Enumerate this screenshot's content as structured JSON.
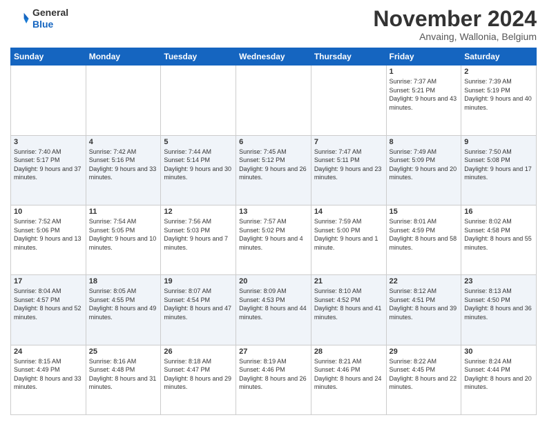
{
  "logo": {
    "general": "General",
    "blue": "Blue"
  },
  "header": {
    "month": "November 2024",
    "location": "Anvaing, Wallonia, Belgium"
  },
  "weekdays": [
    "Sunday",
    "Monday",
    "Tuesday",
    "Wednesday",
    "Thursday",
    "Friday",
    "Saturday"
  ],
  "weeks": [
    [
      {
        "day": "",
        "info": ""
      },
      {
        "day": "",
        "info": ""
      },
      {
        "day": "",
        "info": ""
      },
      {
        "day": "",
        "info": ""
      },
      {
        "day": "",
        "info": ""
      },
      {
        "day": "1",
        "info": "Sunrise: 7:37 AM\nSunset: 5:21 PM\nDaylight: 9 hours and 43 minutes."
      },
      {
        "day": "2",
        "info": "Sunrise: 7:39 AM\nSunset: 5:19 PM\nDaylight: 9 hours and 40 minutes."
      }
    ],
    [
      {
        "day": "3",
        "info": "Sunrise: 7:40 AM\nSunset: 5:17 PM\nDaylight: 9 hours and 37 minutes."
      },
      {
        "day": "4",
        "info": "Sunrise: 7:42 AM\nSunset: 5:16 PM\nDaylight: 9 hours and 33 minutes."
      },
      {
        "day": "5",
        "info": "Sunrise: 7:44 AM\nSunset: 5:14 PM\nDaylight: 9 hours and 30 minutes."
      },
      {
        "day": "6",
        "info": "Sunrise: 7:45 AM\nSunset: 5:12 PM\nDaylight: 9 hours and 26 minutes."
      },
      {
        "day": "7",
        "info": "Sunrise: 7:47 AM\nSunset: 5:11 PM\nDaylight: 9 hours and 23 minutes."
      },
      {
        "day": "8",
        "info": "Sunrise: 7:49 AM\nSunset: 5:09 PM\nDaylight: 9 hours and 20 minutes."
      },
      {
        "day": "9",
        "info": "Sunrise: 7:50 AM\nSunset: 5:08 PM\nDaylight: 9 hours and 17 minutes."
      }
    ],
    [
      {
        "day": "10",
        "info": "Sunrise: 7:52 AM\nSunset: 5:06 PM\nDaylight: 9 hours and 13 minutes."
      },
      {
        "day": "11",
        "info": "Sunrise: 7:54 AM\nSunset: 5:05 PM\nDaylight: 9 hours and 10 minutes."
      },
      {
        "day": "12",
        "info": "Sunrise: 7:56 AM\nSunset: 5:03 PM\nDaylight: 9 hours and 7 minutes."
      },
      {
        "day": "13",
        "info": "Sunrise: 7:57 AM\nSunset: 5:02 PM\nDaylight: 9 hours and 4 minutes."
      },
      {
        "day": "14",
        "info": "Sunrise: 7:59 AM\nSunset: 5:00 PM\nDaylight: 9 hours and 1 minute."
      },
      {
        "day": "15",
        "info": "Sunrise: 8:01 AM\nSunset: 4:59 PM\nDaylight: 8 hours and 58 minutes."
      },
      {
        "day": "16",
        "info": "Sunrise: 8:02 AM\nSunset: 4:58 PM\nDaylight: 8 hours and 55 minutes."
      }
    ],
    [
      {
        "day": "17",
        "info": "Sunrise: 8:04 AM\nSunset: 4:57 PM\nDaylight: 8 hours and 52 minutes."
      },
      {
        "day": "18",
        "info": "Sunrise: 8:05 AM\nSunset: 4:55 PM\nDaylight: 8 hours and 49 minutes."
      },
      {
        "day": "19",
        "info": "Sunrise: 8:07 AM\nSunset: 4:54 PM\nDaylight: 8 hours and 47 minutes."
      },
      {
        "day": "20",
        "info": "Sunrise: 8:09 AM\nSunset: 4:53 PM\nDaylight: 8 hours and 44 minutes."
      },
      {
        "day": "21",
        "info": "Sunrise: 8:10 AM\nSunset: 4:52 PM\nDaylight: 8 hours and 41 minutes."
      },
      {
        "day": "22",
        "info": "Sunrise: 8:12 AM\nSunset: 4:51 PM\nDaylight: 8 hours and 39 minutes."
      },
      {
        "day": "23",
        "info": "Sunrise: 8:13 AM\nSunset: 4:50 PM\nDaylight: 8 hours and 36 minutes."
      }
    ],
    [
      {
        "day": "24",
        "info": "Sunrise: 8:15 AM\nSunset: 4:49 PM\nDaylight: 8 hours and 33 minutes."
      },
      {
        "day": "25",
        "info": "Sunrise: 8:16 AM\nSunset: 4:48 PM\nDaylight: 8 hours and 31 minutes."
      },
      {
        "day": "26",
        "info": "Sunrise: 8:18 AM\nSunset: 4:47 PM\nDaylight: 8 hours and 29 minutes."
      },
      {
        "day": "27",
        "info": "Sunrise: 8:19 AM\nSunset: 4:46 PM\nDaylight: 8 hours and 26 minutes."
      },
      {
        "day": "28",
        "info": "Sunrise: 8:21 AM\nSunset: 4:46 PM\nDaylight: 8 hours and 24 minutes."
      },
      {
        "day": "29",
        "info": "Sunrise: 8:22 AM\nSunset: 4:45 PM\nDaylight: 8 hours and 22 minutes."
      },
      {
        "day": "30",
        "info": "Sunrise: 8:24 AM\nSunset: 4:44 PM\nDaylight: 8 hours and 20 minutes."
      }
    ]
  ]
}
